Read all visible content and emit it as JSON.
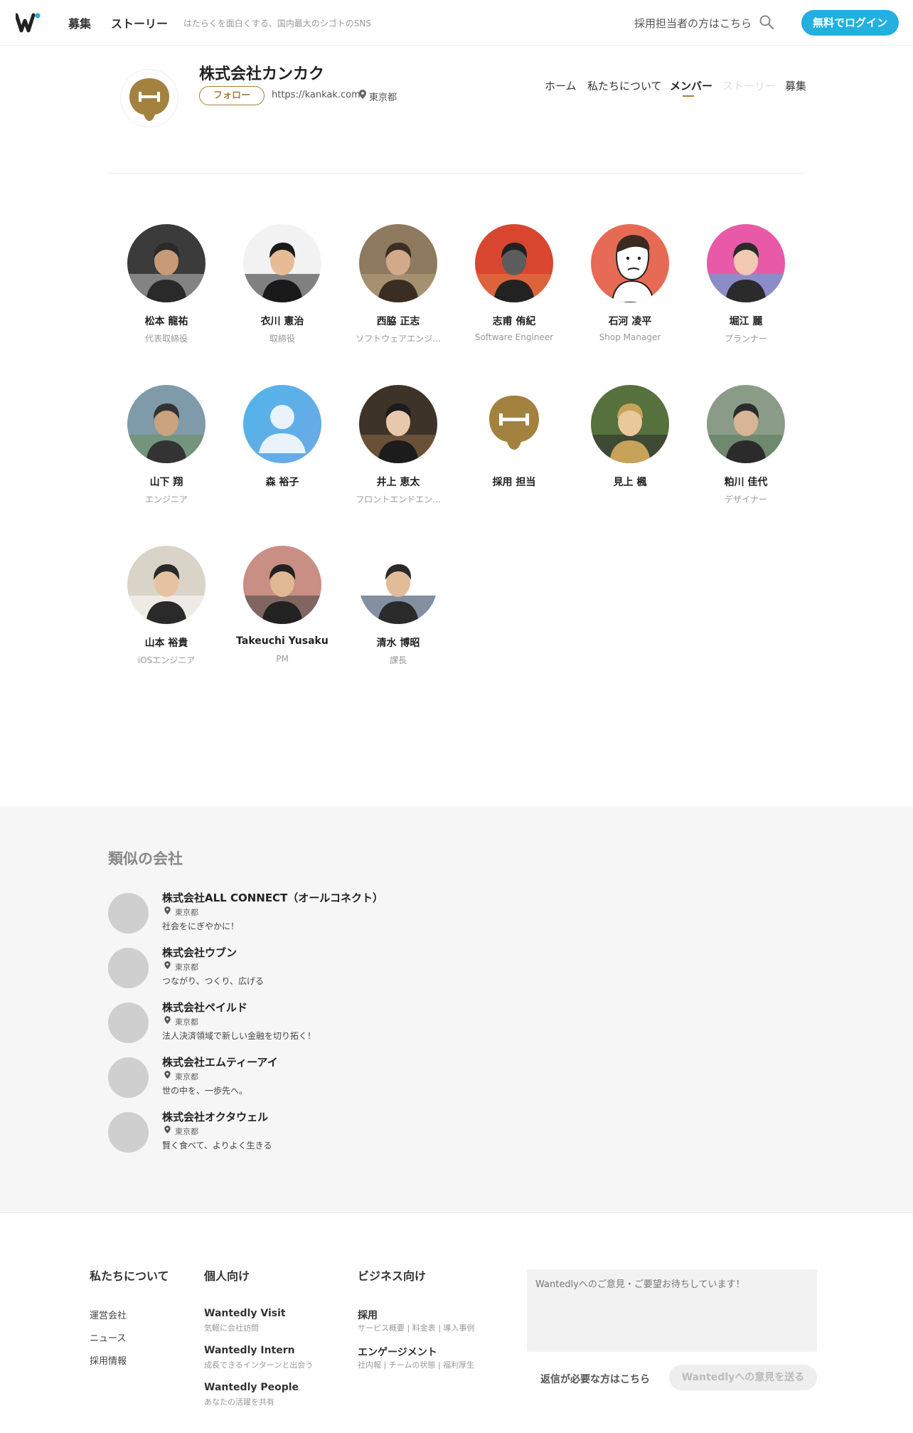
{
  "header": {
    "nav_recruit": "募集",
    "nav_stories": "ストーリー",
    "tagline": "はたらくを面白くする、国内最大のシゴトのSNS",
    "hr_link": "採用担当者の方はこちら",
    "login_button": "無料でログイン",
    "accent_color": "#21b0e0"
  },
  "company": {
    "name": "株式会社カンカク",
    "follow_label": "フォロー",
    "url": "https://kankak.com",
    "location": "東京都",
    "brand_color": "#a3823f",
    "tabs": {
      "home": "ホーム",
      "about": "私たちについて",
      "members": "メンバー",
      "stories": "ストーリー",
      "recruit": "募集"
    },
    "active_tab": "メンバー"
  },
  "members": [
    {
      "name": "松本 龍祐",
      "role": "代表取締役",
      "avatar": "photo"
    },
    {
      "name": "衣川 憲治",
      "role": "取締役",
      "avatar": "photo"
    },
    {
      "name": "西脇 正志",
      "role": "ソフトウェアエンジ...",
      "avatar": "photo"
    },
    {
      "name": "志甫 侑紀",
      "role": "Software Engineer",
      "avatar": "photo"
    },
    {
      "name": "石河 凌平",
      "role": "Shop Manager",
      "avatar": "illustration"
    },
    {
      "name": "堀江 麗",
      "role": "プランナー",
      "avatar": "photo"
    },
    {
      "name": "山下 翔",
      "role": "エンジニア",
      "avatar": "photo"
    },
    {
      "name": "森 裕子",
      "role": "",
      "avatar": "default-user-icon"
    },
    {
      "name": "井上 恵太",
      "role": "フロントエンドエン...",
      "avatar": "photo"
    },
    {
      "name": "採用 担当",
      "role": "",
      "avatar": "company-logo"
    },
    {
      "name": "見上 楓",
      "role": "",
      "avatar": "photo"
    },
    {
      "name": "粕川 佳代",
      "role": "デザイナー",
      "avatar": "photo"
    },
    {
      "name": "山本 裕貴",
      "role": "iOSエンジニア",
      "avatar": "photo"
    },
    {
      "name": "Takeuchi Yusaku",
      "role": "PM",
      "avatar": "photo"
    },
    {
      "name": "清水 博昭",
      "role": "課長",
      "avatar": "photo"
    }
  ],
  "similar": {
    "title": "類似の会社",
    "companies": [
      {
        "name": "株式会社ALL CONNECT（オールコネクト）",
        "location": "東京都",
        "description": "社会をにぎやかに！"
      },
      {
        "name": "株式会社ウブン",
        "location": "東京都",
        "description": "つながり、つくり、広げる"
      },
      {
        "name": "株式会社ペイルド",
        "location": "東京都",
        "description": "法人決済領域で新しい金融を切り拓く！"
      },
      {
        "name": "株式会社エムティーアイ",
        "location": "東京都",
        "description": "世の中を、一歩先へ。"
      },
      {
        "name": "株式会社オクタウェル",
        "location": "東京都",
        "description": "賢く食べて、よりよく生きる"
      }
    ]
  },
  "footer": {
    "about": {
      "title": "私たちについて",
      "links": [
        "運営会社",
        "ニュース",
        "採用情報"
      ]
    },
    "personal": {
      "title": "個人向け",
      "items": [
        {
          "name": "Wantedly Visit",
          "sub": "気軽に会社訪問"
        },
        {
          "name": "Wantedly Intern",
          "sub": "成長できるインターンと出会う"
        },
        {
          "name": "Wantedly People",
          "sub": "あなたの活躍を共有"
        }
      ]
    },
    "business": {
      "title": "ビジネス向け",
      "items": [
        {
          "name": "採用",
          "sub": "サービス概要 | 料金表 | 導入事例"
        },
        {
          "name": "エンゲージメント",
          "sub": "社内報 | チームの状態 | 福利厚生"
        }
      ]
    },
    "feedback_placeholder": "Wantedlyへのご意見・ご要望お待ちしています！",
    "reply_link": "返信が必要な方はこちら",
    "send_button": "Wantedlyへの意見を送る"
  }
}
